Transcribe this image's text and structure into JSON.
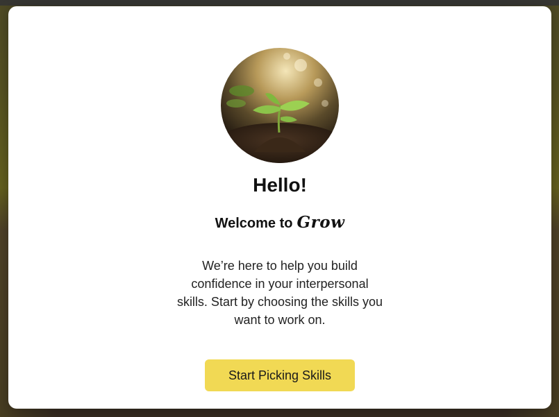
{
  "modal": {
    "heading": "Hello!",
    "welcome_prefix": "Welcome to",
    "brand_name": "Grow",
    "description": "We’re here to help you build confidence in your interpersonal skills. Start by choosing the skills you want to work on.",
    "cta_label": "Start Picking Skills"
  },
  "colors": {
    "cta_background": "#f1d954",
    "modal_background": "#ffffff",
    "text": "#111111"
  },
  "icons": {
    "hero": "seedling-sprout-photo"
  }
}
